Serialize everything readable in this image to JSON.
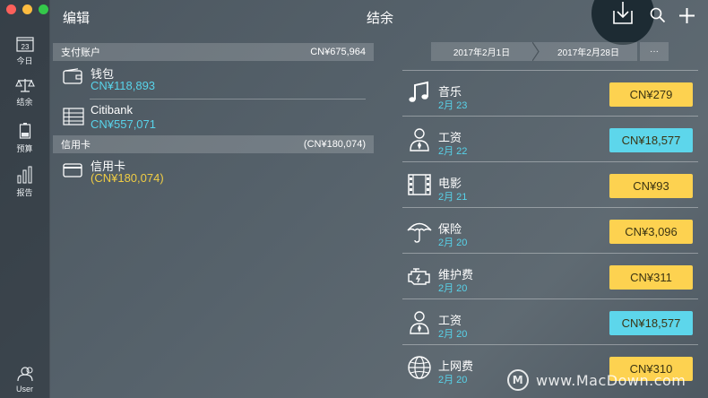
{
  "window": {
    "traffic_colors": [
      "#fc605b",
      "#fdbc40",
      "#34c84a"
    ]
  },
  "header": {
    "edit_label": "编辑",
    "title": "结余",
    "search_icon": "search-icon",
    "add_icon": "plus-icon",
    "download_icon": "download-icon"
  },
  "sidebar": {
    "items": [
      {
        "label": "今日",
        "icon": "calendar-icon",
        "date_number": "23"
      },
      {
        "label": "结余",
        "icon": "scale-icon"
      },
      {
        "label": "预算",
        "icon": "battery-icon"
      },
      {
        "label": "报告",
        "icon": "bar-chart-icon"
      },
      {
        "label": "User",
        "icon": "user-icon"
      }
    ]
  },
  "accounts": {
    "payment_section": {
      "title": "支付账户",
      "total": "CN¥675,964"
    },
    "payment_items": [
      {
        "name": "钱包",
        "amount": "CN¥118,893",
        "icon": "wallet-icon"
      },
      {
        "name": "Citibank",
        "amount": "CN¥557,071",
        "icon": "bank-ledger-icon"
      }
    ],
    "credit_section": {
      "title": "信用卡",
      "total": "(CN¥180,074)"
    },
    "credit_items": [
      {
        "name": "信用卡",
        "amount": "(CN¥180,074)",
        "icon": "credit-card-icon"
      }
    ]
  },
  "date_range": {
    "start": "2017年2月1日",
    "end": "2017年2月28日",
    "more_label": "···"
  },
  "transactions": [
    {
      "name": "音乐",
      "date": "2月 23",
      "amount": "CN¥279",
      "type": "expense",
      "icon": "music-note-icon"
    },
    {
      "name": "工资",
      "date": "2月 22",
      "amount": "CN¥18,577",
      "type": "income",
      "icon": "person-tie-icon"
    },
    {
      "name": "电影",
      "date": "2月 21",
      "amount": "CN¥93",
      "type": "expense",
      "icon": "film-icon"
    },
    {
      "name": "保险",
      "date": "2月 20",
      "amount": "CN¥3,096",
      "type": "expense",
      "icon": "umbrella-icon"
    },
    {
      "name": "维护费",
      "date": "2月 20",
      "amount": "CN¥311",
      "type": "expense",
      "icon": "engine-icon"
    },
    {
      "name": "工资",
      "date": "2月 20",
      "amount": "CN¥18,577",
      "type": "income",
      "icon": "person-tie-icon"
    },
    {
      "name": "上网费",
      "date": "2月 20",
      "amount": "CN¥310",
      "type": "expense",
      "icon": "globe-icon"
    }
  ],
  "colors": {
    "expense": "#fdd250",
    "income": "#5dd6eb",
    "accent": "#58d3ea",
    "negative": "#f0cd44"
  },
  "watermark": {
    "logo_letter": "M",
    "text": "www.MacDown.com"
  }
}
